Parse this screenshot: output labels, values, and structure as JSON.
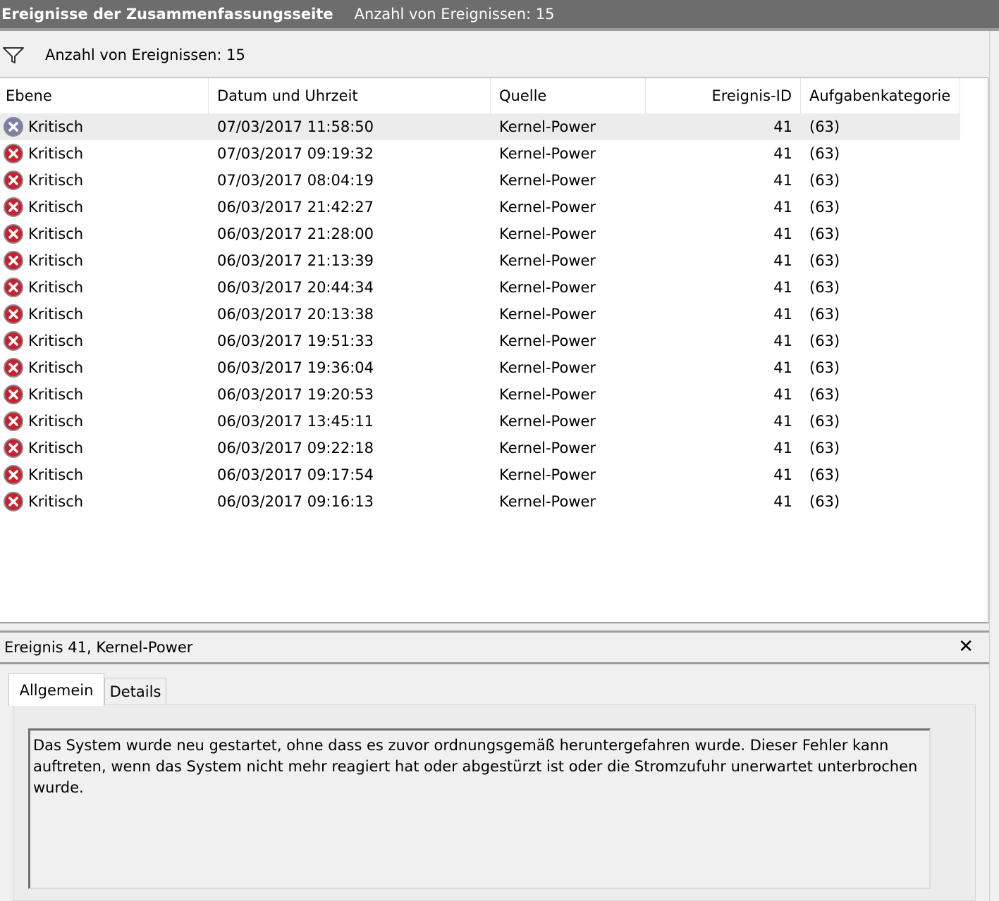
{
  "window": {
    "title": "Ereignisse der Zusammenfassungsseite",
    "count_label": "Anzahl von Ereignissen: 15"
  },
  "filter": {
    "icon": "filter-icon",
    "label": "Anzahl von Ereignissen: 15"
  },
  "columns": {
    "level": "Ebene",
    "datetime": "Datum und Uhrzeit",
    "source": "Quelle",
    "event_id": "Ereignis-ID",
    "task_category": "Aufgabenkategorie"
  },
  "events": [
    {
      "level": "Kritisch",
      "datetime": "07/03/2017 11:58:50",
      "source": "Kernel-Power",
      "event_id": "41",
      "task_category": "(63)"
    },
    {
      "level": "Kritisch",
      "datetime": "07/03/2017 09:19:32",
      "source": "Kernel-Power",
      "event_id": "41",
      "task_category": "(63)"
    },
    {
      "level": "Kritisch",
      "datetime": "07/03/2017 08:04:19",
      "source": "Kernel-Power",
      "event_id": "41",
      "task_category": "(63)"
    },
    {
      "level": "Kritisch",
      "datetime": "06/03/2017 21:42:27",
      "source": "Kernel-Power",
      "event_id": "41",
      "task_category": "(63)"
    },
    {
      "level": "Kritisch",
      "datetime": "06/03/2017 21:28:00",
      "source": "Kernel-Power",
      "event_id": "41",
      "task_category": "(63)"
    },
    {
      "level": "Kritisch",
      "datetime": "06/03/2017 21:13:39",
      "source": "Kernel-Power",
      "event_id": "41",
      "task_category": "(63)"
    },
    {
      "level": "Kritisch",
      "datetime": "06/03/2017 20:44:34",
      "source": "Kernel-Power",
      "event_id": "41",
      "task_category": "(63)"
    },
    {
      "level": "Kritisch",
      "datetime": "06/03/2017 20:13:38",
      "source": "Kernel-Power",
      "event_id": "41",
      "task_category": "(63)"
    },
    {
      "level": "Kritisch",
      "datetime": "06/03/2017 19:51:33",
      "source": "Kernel-Power",
      "event_id": "41",
      "task_category": "(63)"
    },
    {
      "level": "Kritisch",
      "datetime": "06/03/2017 19:36:04",
      "source": "Kernel-Power",
      "event_id": "41",
      "task_category": "(63)"
    },
    {
      "level": "Kritisch",
      "datetime": "06/03/2017 19:20:53",
      "source": "Kernel-Power",
      "event_id": "41",
      "task_category": "(63)"
    },
    {
      "level": "Kritisch",
      "datetime": "06/03/2017 13:45:11",
      "source": "Kernel-Power",
      "event_id": "41",
      "task_category": "(63)"
    },
    {
      "level": "Kritisch",
      "datetime": "06/03/2017 09:22:18",
      "source": "Kernel-Power",
      "event_id": "41",
      "task_category": "(63)"
    },
    {
      "level": "Kritisch",
      "datetime": "06/03/2017 09:17:54",
      "source": "Kernel-Power",
      "event_id": "41",
      "task_category": "(63)"
    },
    {
      "level": "Kritisch",
      "datetime": "06/03/2017 09:16:13",
      "source": "Kernel-Power",
      "event_id": "41",
      "task_category": "(63)"
    }
  ],
  "selected_index": 0,
  "detail": {
    "title": "Ereignis 41, Kernel-Power",
    "close_icon": "close-icon",
    "tabs": [
      "Allgemein",
      "Details"
    ],
    "active_tab": "Allgemein",
    "description": "Das System wurde neu gestartet, ohne dass es zuvor ordnungsgemäß heruntergefahren wurde. Dieser Fehler kann auftreten, wenn das System nicht mehr reagiert hat oder abgestürzt ist oder die Stromzufuhr unerwartet unterbrochen wurde."
  },
  "colors": {
    "titlebar": "#6d6d6d",
    "error_icon": "#c8202f",
    "selected_row": "#ececec"
  }
}
